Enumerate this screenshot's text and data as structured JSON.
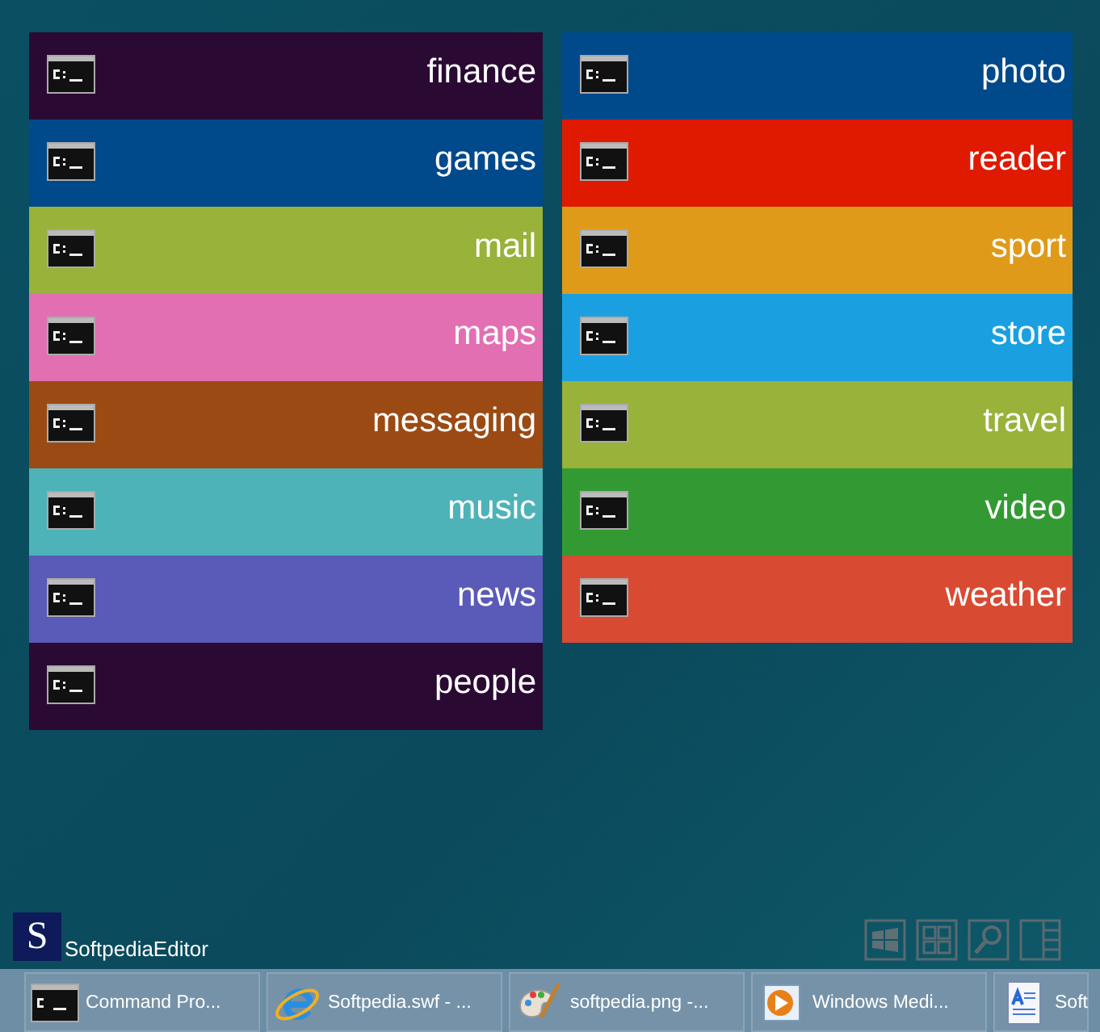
{
  "tile_columns": [
    [
      {
        "label": "finance",
        "color": "#2a0a33"
      },
      {
        "label": "games",
        "color": "#00498a"
      },
      {
        "label": "mail",
        "color": "#98b23a"
      },
      {
        "label": "maps",
        "color": "#e36fb3"
      },
      {
        "label": "messaging",
        "color": "#9b4a14"
      },
      {
        "label": "music",
        "color": "#4db3b8"
      },
      {
        "label": "news",
        "color": "#5a5ab8"
      },
      {
        "label": "people",
        "color": "#2a0a33"
      }
    ],
    [
      {
        "label": "photo",
        "color": "#00498a"
      },
      {
        "label": "reader",
        "color": "#e01a00"
      },
      {
        "label": "sport",
        "color": "#e09a1a"
      },
      {
        "label": "store",
        "color": "#1aa0e0"
      },
      {
        "label": "travel",
        "color": "#98b23a"
      },
      {
        "label": "video",
        "color": "#339a33"
      },
      {
        "label": "weather",
        "color": "#d94a33"
      }
    ]
  ],
  "user": {
    "initial": "S",
    "name": "SoftpediaEditor"
  },
  "taskbar": [
    {
      "kind": "console",
      "label": "Command Pro..."
    },
    {
      "kind": "browser",
      "label": "Softpedia.swf - ..."
    },
    {
      "kind": "paint",
      "label": "softpedia.png -..."
    },
    {
      "kind": "media",
      "label": "Windows Medi..."
    },
    {
      "kind": "document",
      "label": "Soft"
    }
  ]
}
